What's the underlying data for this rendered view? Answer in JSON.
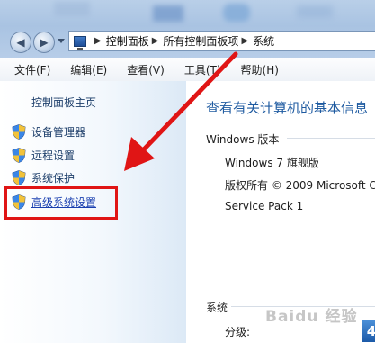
{
  "address_bar": {
    "crumbs": [
      "控制面板",
      "所有控制面板项",
      "系统"
    ]
  },
  "menu": {
    "items": [
      "文件(F)",
      "编辑(E)",
      "查看(V)",
      "工具(T)",
      "帮助(H)"
    ]
  },
  "left_pane": {
    "home_link": "控制面板主页",
    "tasks": [
      "设备管理器",
      "远程设置",
      "系统保护",
      "高级系统设置"
    ]
  },
  "main": {
    "title": "查看有关计算机的基本信息",
    "windows_edition_header": "Windows 版本",
    "edition": "Windows 7 旗舰版",
    "copyright": "版权所有 © 2009 Microsoft Co",
    "service_pack": "Service Pack 1",
    "system_header": "系统",
    "rating_label": "分级:",
    "rating_value": "4"
  },
  "watermark": "Baidu 经验",
  "colors": {
    "highlight_box": "#e01515",
    "annotation_arrow": "#e01515",
    "link": "#1e3f6b",
    "title": "#1e5aa0"
  }
}
